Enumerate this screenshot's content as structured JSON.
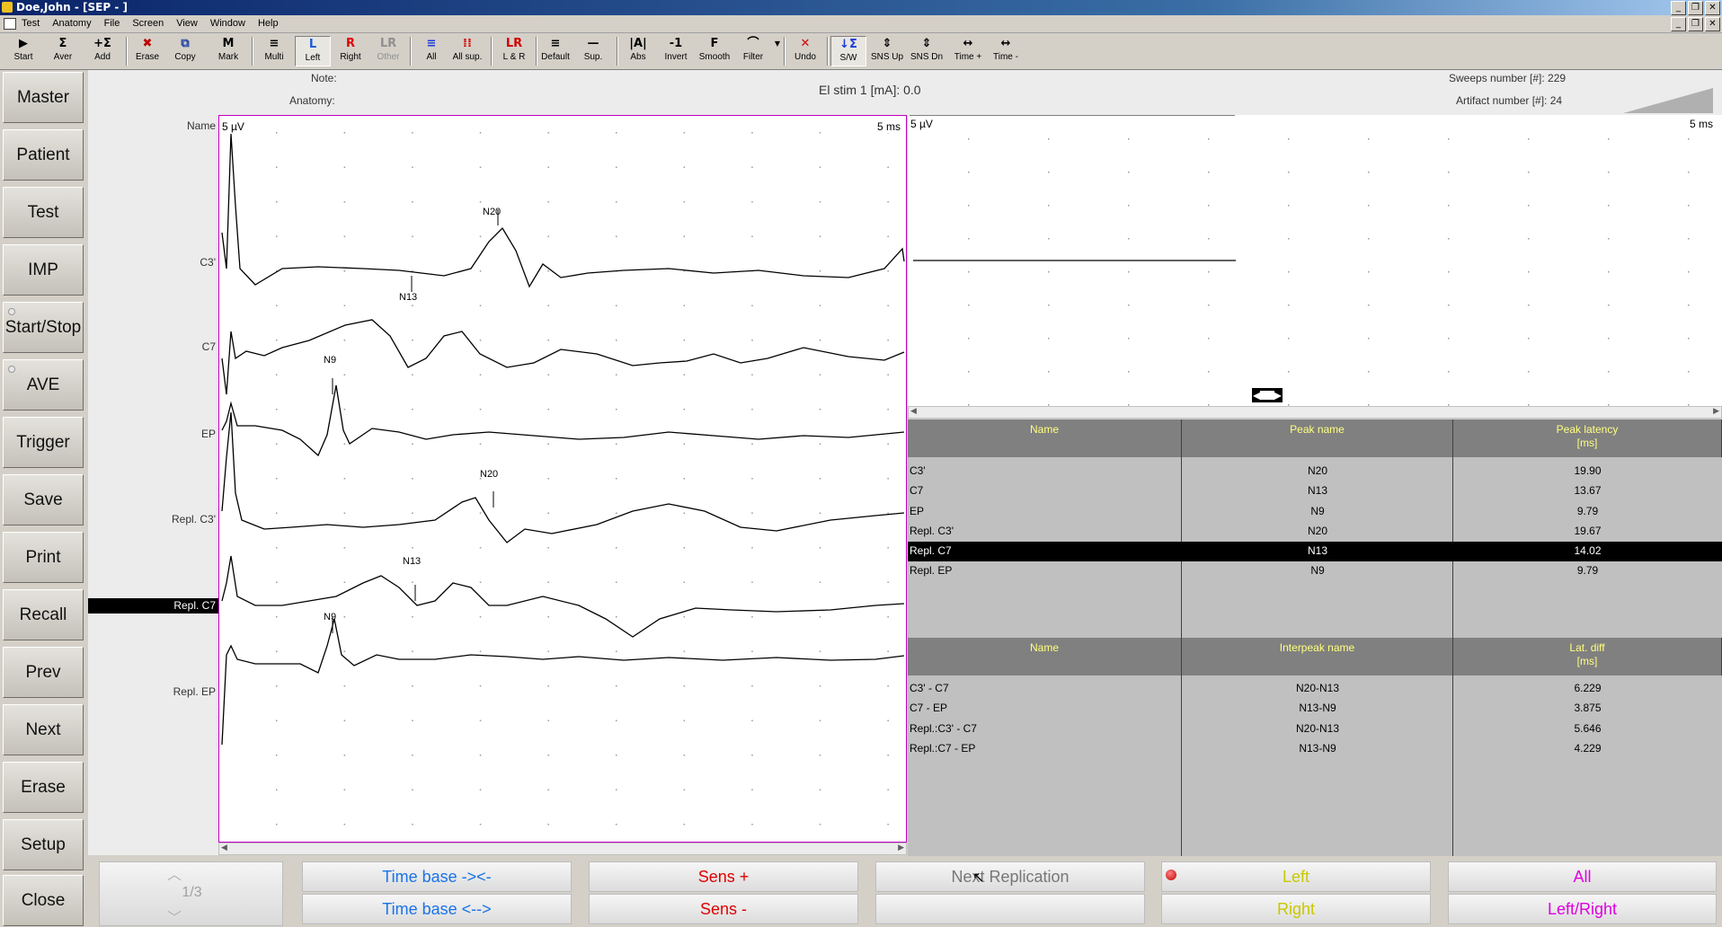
{
  "window": {
    "title": "Doe,John - [SEP - ]"
  },
  "menu": [
    "Test",
    "Anatomy",
    "File",
    "Screen",
    "View",
    "Window",
    "Help"
  ],
  "toolbar": {
    "buttons": [
      {
        "id": "start",
        "icon": "▶",
        "label": "Start"
      },
      {
        "id": "aver",
        "icon": "Σ",
        "label": "Aver"
      },
      {
        "id": "add",
        "icon": "+Σ",
        "label": "Add"
      },
      {
        "id": "erase",
        "icon": "✖",
        "label": "Erase"
      },
      {
        "id": "copy",
        "icon": "⧉",
        "label": "Copy"
      },
      {
        "id": "mark",
        "icon": "M",
        "label": "Mark"
      },
      {
        "id": "multi",
        "icon": "≡",
        "label": "Multi"
      },
      {
        "id": "left",
        "icon": "L",
        "label": "Left"
      },
      {
        "id": "right",
        "icon": "R",
        "label": "Right"
      },
      {
        "id": "other",
        "icon": "LR",
        "label": "Other"
      },
      {
        "id": "all",
        "icon": "≡",
        "label": "All"
      },
      {
        "id": "allsup",
        "icon": "⁞⁞",
        "label": "All sup."
      },
      {
        "id": "lr",
        "icon": "LR",
        "label": "L & R"
      },
      {
        "id": "default",
        "icon": "≡",
        "label": "Default"
      },
      {
        "id": "sup",
        "icon": "—",
        "label": "Sup."
      },
      {
        "id": "abs",
        "icon": "|A|",
        "label": "Abs"
      },
      {
        "id": "invert",
        "icon": "-1",
        "label": "Invert"
      },
      {
        "id": "smooth",
        "icon": "F",
        "label": "Smooth"
      },
      {
        "id": "filter",
        "icon": "⌒",
        "label": "Filter"
      },
      {
        "id": "undo",
        "icon": "✕",
        "label": "Undo"
      },
      {
        "id": "sw",
        "icon": "↓Σ",
        "label": "S/W"
      },
      {
        "id": "snsup",
        "icon": "⇕",
        "label": "SNS Up"
      },
      {
        "id": "snsdn",
        "icon": "⇕",
        "label": "SNS Dn"
      },
      {
        "id": "timeplus",
        "icon": "↔",
        "label": "Time +"
      },
      {
        "id": "timeminus",
        "icon": "↔",
        "label": "Time -"
      }
    ]
  },
  "sidebar": {
    "buttons": [
      "Master",
      "Patient",
      "Test",
      "IMP",
      "Start/Stop",
      "AVE",
      "Trigger",
      "Save",
      "Print",
      "Recall",
      "Prev",
      "Next",
      "Erase",
      "Setup",
      "Close"
    ]
  },
  "info": {
    "note_label": "Note:",
    "anatomy_label": "Anatomy:",
    "stim": "El stim 1 [mA]: 0.0",
    "sweeps": "Sweeps number [#]: 229",
    "artifact": "Artifact number [#]: 24"
  },
  "left_plot": {
    "name_header": "Name",
    "scale_v": "5 µV",
    "scale_t": "5 ms",
    "selected_label": "Repl. C7",
    "traces": [
      {
        "name": "C3'",
        "peak": "N20",
        "latency_ms": 19.9
      },
      {
        "name": "C7",
        "peak": "N13",
        "latency_ms": 13.67
      },
      {
        "name": "EP",
        "peak": "N9",
        "latency_ms": 9.79
      },
      {
        "name": "Repl. C3'",
        "peak": "N20",
        "latency_ms": 19.67
      },
      {
        "name": "Repl. C7",
        "peak": "N13",
        "latency_ms": 14.02
      },
      {
        "name": "Repl. EP",
        "peak": "N9",
        "latency_ms": 9.79
      }
    ]
  },
  "right_plot": {
    "scale_v": "5 µV",
    "scale_t": "5 ms"
  },
  "peak_table": {
    "headers": [
      "Name",
      "Peak name",
      "Peak latency\n[ms]"
    ],
    "selected_index": 4,
    "rows": [
      [
        "C3'",
        "N20",
        "19.90"
      ],
      [
        "C7",
        "N13",
        "13.67"
      ],
      [
        "EP",
        "N9",
        "9.79"
      ],
      [
        "Repl. C3'",
        "N20",
        "19.67"
      ],
      [
        "Repl. C7",
        "N13",
        "14.02"
      ],
      [
        "Repl. EP",
        "N9",
        "9.79"
      ]
    ]
  },
  "interpeak_table": {
    "headers": [
      "Name",
      "Interpeak name",
      "Lat. diff\n[ms]"
    ],
    "rows": [
      [
        "C3' - C7",
        "N20-N13",
        "6.229"
      ],
      [
        "C7 - EP",
        "N13-N9",
        "3.875"
      ],
      [
        "Repl.:C3' - C7",
        "N20-N13",
        "5.646"
      ],
      [
        "Repl.:C7 - EP",
        "N13-N9",
        "4.229"
      ]
    ]
  },
  "bottom": {
    "page": "1/3",
    "time_in": "Time base -><-",
    "time_out": "Time base <-->",
    "sens_plus": "Sens +",
    "sens_minus": "Sens -",
    "next_rep": "Next Replication",
    "left": "Left",
    "right": "Right",
    "all": "All",
    "left_right": "Left/Right"
  },
  "colors": {
    "blue": "#1a73e8",
    "red": "#e00000",
    "yellow": "#c8c800",
    "magenta": "#e000e0",
    "gray": "#777777"
  }
}
